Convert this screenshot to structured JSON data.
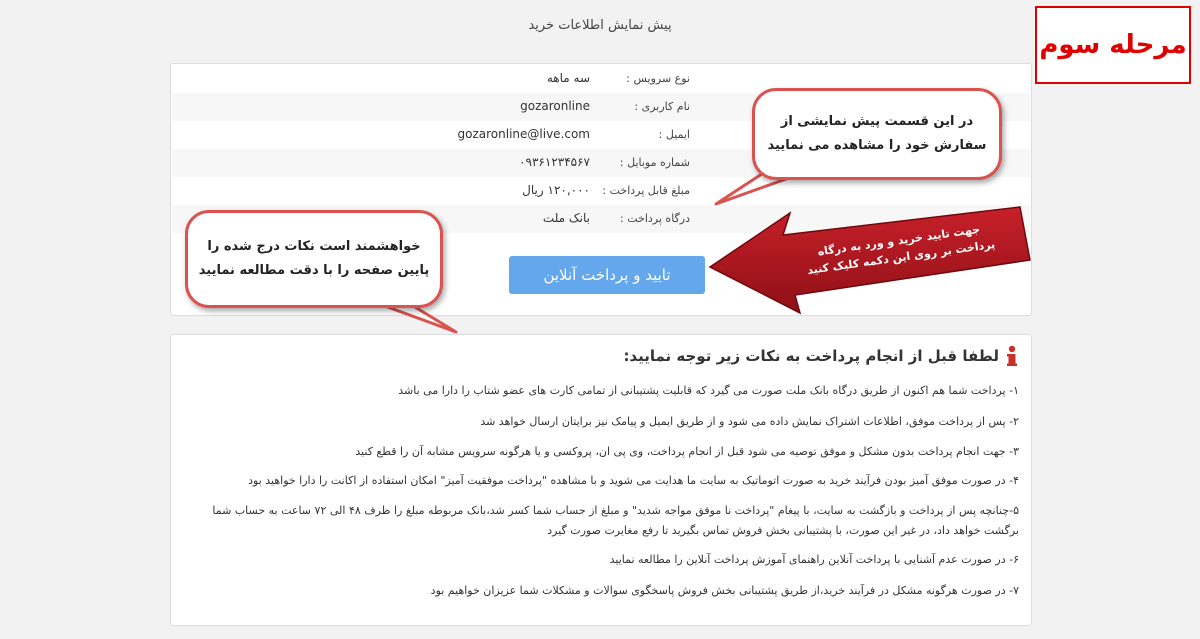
{
  "page": {
    "title": "پیش نمایش اطلاعات خرید"
  },
  "stage": {
    "label": "مرحله سوم"
  },
  "order_info": {
    "rows": [
      {
        "label": "نوع سرویس :",
        "value": "سه ماهه"
      },
      {
        "label": "نام کاربری :",
        "value": "gozaronline"
      },
      {
        "label": "ایمیل :",
        "value": "gozaronline@live.com"
      },
      {
        "label": "شماره موبایل :",
        "value": "۰۹۳۶۱۲۳۴۵۶۷"
      },
      {
        "label": "مبلغ قابل پرداخت :",
        "value": "۱۲۰,۰۰۰ ریال"
      },
      {
        "label": "درگاه پرداخت :",
        "value": "بانک ملت"
      }
    ]
  },
  "pay_button": {
    "label": "تایید و پرداخت آنلاین"
  },
  "callouts": {
    "preview": [
      "در این قسمت پیش نمایشی از",
      "سفارش خود را مشاهده می نمایید"
    ],
    "read_notes": [
      "خواهشمند است نکات درج شده را",
      "پایین صفحه را با دقت مطالعه نمایید"
    ]
  },
  "arrow_hint": [
    "جهت تایید خرید و ورد به درگاه",
    "پرداخت بر روی این دکمه کلیک کنید"
  ],
  "notes": {
    "title": "لطفا قبل از انجام پرداخت به نکات زیر توجه نمایید:",
    "items": [
      "۱- پرداخت شما هم اکنون از طریق درگاه بانک ملت صورت می گیرد که قابلیت پشتیبانی از تمامی کارت های عضو شتاب را دارا می باشد",
      "۲- پس از پرداخت موفق، اطلاعات اشتراک نمایش داده می شود و از طریق ایمیل و پیامک نیز برایتان ارسال خواهد شد",
      "۳- جهت انجام پرداخت بدون مشکل و موفق توصیه می شود قبل از انجام پرداخت، وی پی ان، پروکسی و یا هرگونه سرویس مشابه آن را قطع کنید",
      "۴- در صورت موفق آمیز بودن فرآیند خرید به صورت اتوماتیک به سایت ما هدایت می شوید و با مشاهده \"پرداخت موفقیت آمیز\" امکان استفاده از اکانت را دارا خواهید بود",
      "۵-چنانچه پس از پرداخت و بازگشت به سایت، با پیغام \"پرداخت نا موفق مواجه شدید\" و مبلغ از حساب شما کسر شد،بانک مربوطه مبلغ را ظرف ۴۸ الی ۷۲ ساعت به حساب شما برگشت خواهد داد، در غیر این صورت، با پشتیبانی بخش فروش تماس بگیرید تا رفع مغایرت صورت گیرد",
      "۶- در صورت عدم آشنایی با پرداخت آنلاین راهنمای آموزش پرداخت آنلاین را مطالعه نمایید",
      "۷- در صورت هرگونه مشکل در فرآیند خرید،از طریق پشتیبانی بخش فروش پاسخگوی سوالات و مشکلات شما عزیزان خواهیم بود"
    ]
  },
  "colors": {
    "stage_red": "#e00000",
    "callout_border": "#d9534f",
    "button_blue": "#64a7ec",
    "arrow_red": "#b01820",
    "info_icon_red": "#c9302c"
  }
}
